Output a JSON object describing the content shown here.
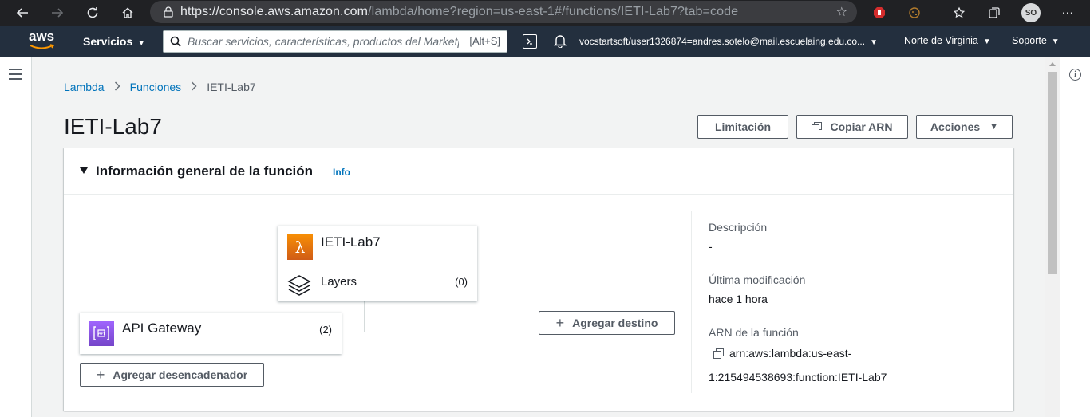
{
  "browser": {
    "url_prefix": "https://",
    "url_host": "console.aws.amazon.com",
    "url_path": "/lambda/home?region=us-east-1#/functions/IETI-Lab7?tab=code",
    "profile_initials": "SO"
  },
  "aws_header": {
    "logo": "aws",
    "services_label": "Servicios",
    "search_placeholder": "Buscar servicios, características, productos del Marketplace y documentos",
    "search_shortcut": "[Alt+S]",
    "account": "vocstartsoft/user1326874=andres.sotelo@mail.escuelaing.edu.co...",
    "region": "Norte de Virginia",
    "support": "Soporte"
  },
  "breadcrumb": {
    "items": [
      "Lambda",
      "Funciones"
    ],
    "current": "IETI-Lab7"
  },
  "page": {
    "title": "IETI-Lab7"
  },
  "actions": {
    "throttle": "Limitación",
    "copy_arn": "Copiar ARN",
    "actions": "Acciones"
  },
  "overview": {
    "title": "Información general de la función",
    "info_link": "Info",
    "function_name": "IETI-Lab7",
    "layers_label": "Layers",
    "layers_count": "(0)",
    "trigger_name": "API Gateway",
    "trigger_count": "(2)",
    "add_trigger": "Agregar desencadenador",
    "add_destination": "Agregar destino"
  },
  "details": {
    "description_label": "Descripción",
    "description_value": "-",
    "modified_label": "Última modificación",
    "modified_value": "hace 1 hora",
    "arn_label": "ARN de la función",
    "arn_line1": "arn:aws:lambda:us-east-",
    "arn_line2": "1:215494538693:function:IETI-Lab7"
  },
  "icons": {
    "lambda": "lambda-icon",
    "api_gateway": "api-gateway-icon",
    "layers": "layers-icon",
    "copy": "copy-icon"
  },
  "colors": {
    "link": "#0073bb",
    "aws_nav": "#232f3e",
    "lambda_orange": "#d05c17",
    "apigw_purple": "#7546c9"
  }
}
